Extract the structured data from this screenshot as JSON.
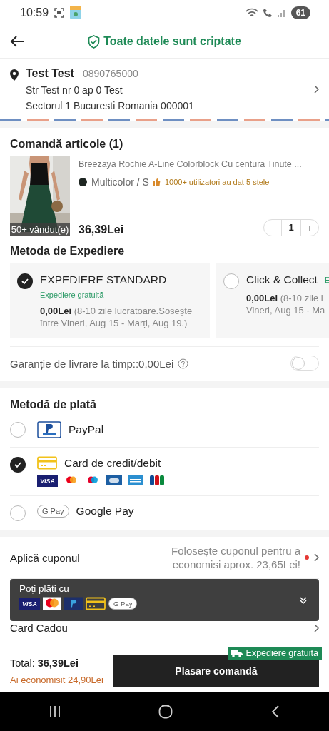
{
  "status_bar": {
    "time": "10:59",
    "battery": "61"
  },
  "header": {
    "title": "Toate datele sunt criptate"
  },
  "address": {
    "name": "Test Test",
    "phone": "0890765000",
    "line_1": "Str Test nr 0 ap 0 Test",
    "line_2": "Sectorul 1 Bucuresti Romania 000001"
  },
  "order_items": {
    "title": "Comandă articole (1)",
    "items": [
      {
        "kind": "picture",
        "sold_badge": "50+ vândut(e)",
        "name": "Breezaya Rochie A-Line Colorblock Cu centura Tinute ...",
        "variant": "Multicolor / S",
        "color": "#1e2622",
        "rating_note": "1000+ utilizatori au dat 5 stele",
        "price": "36,39Lei",
        "minus": "−",
        "quantity": "1",
        "plus": "+"
      }
    ]
  },
  "shipping": {
    "title": "Metoda de Expediere",
    "options": [
      {
        "name": "EXPEDIERE STANDARD",
        "tag": "Expediere gratuită",
        "price": "0,00Lei",
        "detail_lines": [
          "(8-10 zile lucrătoare.Sosește",
          "între Vineri, Aug 15 - Marți, Aug 19.)"
        ],
        "selected": true
      },
      {
        "name": "Click & Collect",
        "tag": "E",
        "price": "0,00Lei",
        "detail_lines": [
          "(8-10 zile l",
          "Vineri, Aug 15 - Ma"
        ],
        "selected": false
      }
    ]
  },
  "guarantee": {
    "label": "Garanție de livrare la timp::0,00Lei",
    "on": false
  },
  "payment": {
    "title": "Metodă de plată",
    "methods": [
      {
        "kind": "paypal",
        "name": "PayPal",
        "selected": false
      },
      {
        "kind": "card",
        "name": "Card de credit/debit",
        "selected": true,
        "brands": [
          {
            "kind": "visa",
            "label": "VISA"
          },
          {
            "kind": "mastercard"
          },
          {
            "kind": "maestro"
          },
          {
            "kind": "cb"
          },
          {
            "kind": "amex"
          },
          {
            "kind": "jcb"
          }
        ]
      },
      {
        "kind": "gpay",
        "name": "Google Pay",
        "icon_label": "G Pay",
        "selected": false
      }
    ]
  },
  "coupon": {
    "label": "Aplică cuponul",
    "hint": "Folosește cuponul pentru a economisi aprox. 23,65Lei!",
    "new_dot": true
  },
  "gift_card": {
    "label": "Card Cadou"
  },
  "pay_with_popup": {
    "title": "Poți plăti cu",
    "methods": [
      {
        "kind": "visa",
        "label": "VISA"
      },
      {
        "kind": "mastercard"
      },
      {
        "kind": "paypal"
      },
      {
        "kind": "card"
      },
      {
        "kind": "gpay",
        "label": "G Pay"
      }
    ]
  },
  "footer": {
    "total_label": "Total:",
    "total": "36,39Lei",
    "savings": "Ai economisit 24,90Lei",
    "badge": "Expediere gratuită",
    "button": "Plasare comandă"
  }
}
